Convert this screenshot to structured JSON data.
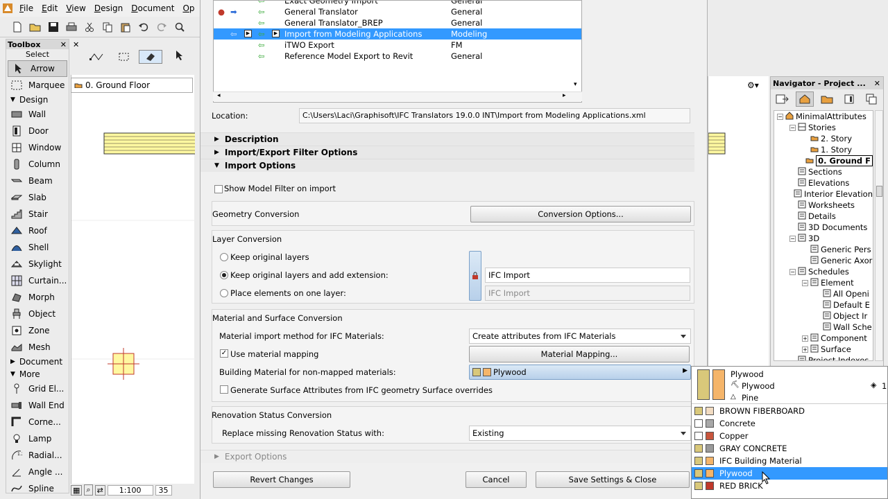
{
  "menubar": {
    "items": [
      {
        "label": "File",
        "accel": "F"
      },
      {
        "label": "Edit",
        "accel": "E"
      },
      {
        "label": "View",
        "accel": "V"
      },
      {
        "label": "Design",
        "accel": "D"
      },
      {
        "label": "Document",
        "accel": "D"
      },
      {
        "label": "Op",
        "accel": "O"
      }
    ]
  },
  "toolbox": {
    "title": "Toolbox",
    "select_label": "Select",
    "arrow": "Arrow",
    "marquee": "Marquee",
    "design_group": "Design",
    "design_tools": [
      "Wall",
      "Door",
      "Window",
      "Column",
      "Beam",
      "Slab",
      "Stair",
      "Roof",
      "Shell",
      "Skylight",
      "Curtain...",
      "Morph",
      "Object",
      "Zone",
      "Mesh"
    ],
    "document_group": "Document",
    "more_group": "More",
    "more_tools": [
      "Grid El...",
      "Wall End",
      "Corne...",
      "Lamp",
      "Radial...",
      "Angle ...",
      "Spline"
    ]
  },
  "canvas": {
    "tab_label": "0. Ground Floor",
    "zoom": "1:100",
    "zoom2": "35"
  },
  "navigator": {
    "title": "Navigator - Project ...",
    "tree": [
      {
        "label": "MinimalAttributes",
        "level": 0,
        "icon": "project-icon"
      },
      {
        "label": "Stories",
        "level": 1,
        "icon": "stories-icon"
      },
      {
        "label": "2. Story",
        "level": 2,
        "icon": "story-icon"
      },
      {
        "label": "1. Story",
        "level": 2,
        "icon": "story-icon"
      },
      {
        "label": "0. Ground F",
        "level": 2,
        "icon": "story-icon",
        "selected": true
      },
      {
        "label": "Sections",
        "level": 1,
        "icon": "section-icon"
      },
      {
        "label": "Elevations",
        "level": 1,
        "icon": "elevation-icon"
      },
      {
        "label": "Interior Elevation",
        "level": 1,
        "icon": "interior-elevation-icon"
      },
      {
        "label": "Worksheets",
        "level": 1,
        "icon": "worksheet-icon"
      },
      {
        "label": "Details",
        "level": 1,
        "icon": "detail-icon"
      },
      {
        "label": "3D Documents",
        "level": 1,
        "icon": "3d-document-icon"
      },
      {
        "label": "3D",
        "level": 1,
        "icon": "3d-icon"
      },
      {
        "label": "Generic Pers",
        "level": 2,
        "icon": "perspective-icon"
      },
      {
        "label": "Generic Axor",
        "level": 2,
        "icon": "axonometry-icon"
      },
      {
        "label": "Schedules",
        "level": 1,
        "icon": "schedule-icon"
      },
      {
        "label": "Element",
        "level": 2,
        "icon": "element-schedule-icon"
      },
      {
        "label": "All Openi",
        "level": 3,
        "icon": "table-icon"
      },
      {
        "label": "Default E",
        "level": 3,
        "icon": "table-icon"
      },
      {
        "label": "Object Ir",
        "level": 3,
        "icon": "table-icon"
      },
      {
        "label": "Wall Sche",
        "level": 3,
        "icon": "table-icon"
      },
      {
        "label": "Component",
        "level": 2,
        "icon": "component-icon"
      },
      {
        "label": "Surface",
        "level": 2,
        "icon": "surface-icon"
      },
      {
        "label": "Project Indexes",
        "level": 1,
        "icon": "index-icon"
      }
    ]
  },
  "translators": [
    {
      "name": "Exact Geometry Import",
      "type": "General",
      "locked": false
    },
    {
      "name": "General Translator",
      "type": "General",
      "locked": true
    },
    {
      "name": "General Translator_BREP",
      "type": "General",
      "locked": false
    },
    {
      "name": "Import from Modeling Applications",
      "type": "Modeling",
      "locked": false,
      "selected": true
    },
    {
      "name": "iTWO Export",
      "type": "FM",
      "locked": false
    },
    {
      "name": "Reference Model Export to Revit",
      "type": "General",
      "locked": false
    }
  ],
  "location": {
    "label": "Location:",
    "value": "C:\\Users\\Laci\\Graphisoft\\IFC Translators 19.0.0 INT\\Import from Modeling Applications.xml"
  },
  "sections": {
    "description": "Description",
    "filter_options": "Import/Export Filter Options",
    "import_options": "Import Options",
    "export_options": "Export Options"
  },
  "import_options": {
    "show_model_filter": "Show Model Filter on import",
    "geometry_conversion": "Geometry Conversion",
    "conversion_options_btn": "Conversion Options...",
    "layer_conversion": "Layer Conversion",
    "keep_original_layers": "Keep original layers",
    "keep_layers_extension": "Keep original layers and add extension:",
    "place_one_layer": "Place elements on one layer:",
    "extension_value": "IFC Import",
    "one_layer_value": "IFC Import",
    "material_conversion": "Material and Surface Conversion",
    "material_method_label": "Material import method for IFC Materials:",
    "material_method_value": "Create attributes from IFC Materials",
    "use_material_mapping": "Use material mapping",
    "material_mapping_btn": "Material Mapping...",
    "building_material_label": "Building Material for non-mapped materials:",
    "building_material_value": "Plywood",
    "generate_surface": "Generate Surface Attributes from IFC geometry Surface overrides",
    "renovation_conversion": "Renovation Status Conversion",
    "renovation_label": "Replace missing Renovation Status with:",
    "renovation_value": "Existing"
  },
  "buttons": {
    "revert": "Revert Changes",
    "cancel": "Cancel",
    "save_close": "Save Settings & Close"
  },
  "material_popup": {
    "preview_title": "Plywood",
    "preview_sub1": "Plywood",
    "preview_sub2": "Pine",
    "preview_num": "1",
    "items": [
      {
        "name": "BROWN FIBERBOARD",
        "color": "#f2dcc2",
        "fill": "#d9c87a"
      },
      {
        "name": "Concrete",
        "color": "#a8a8a8",
        "fill": "#ffffff"
      },
      {
        "name": "Copper",
        "color": "#c8553d",
        "fill": "#ffffff"
      },
      {
        "name": "GRAY CONCRETE",
        "color": "#9a9a9a",
        "fill": "#d9c87a"
      },
      {
        "name": "IFC Building Material",
        "color": "#f5b56a",
        "fill": "#d9c87a"
      },
      {
        "name": "Plywood",
        "color": "#f5b56a",
        "fill": "#d9c87a",
        "selected": true
      },
      {
        "name": "RED BRICK",
        "color": "#c0392b",
        "fill": "#d9c87a"
      }
    ]
  },
  "colors": {
    "selection": "#3399ff",
    "wall_fill": "#fff8a0",
    "plywood": "#f5b56a"
  }
}
